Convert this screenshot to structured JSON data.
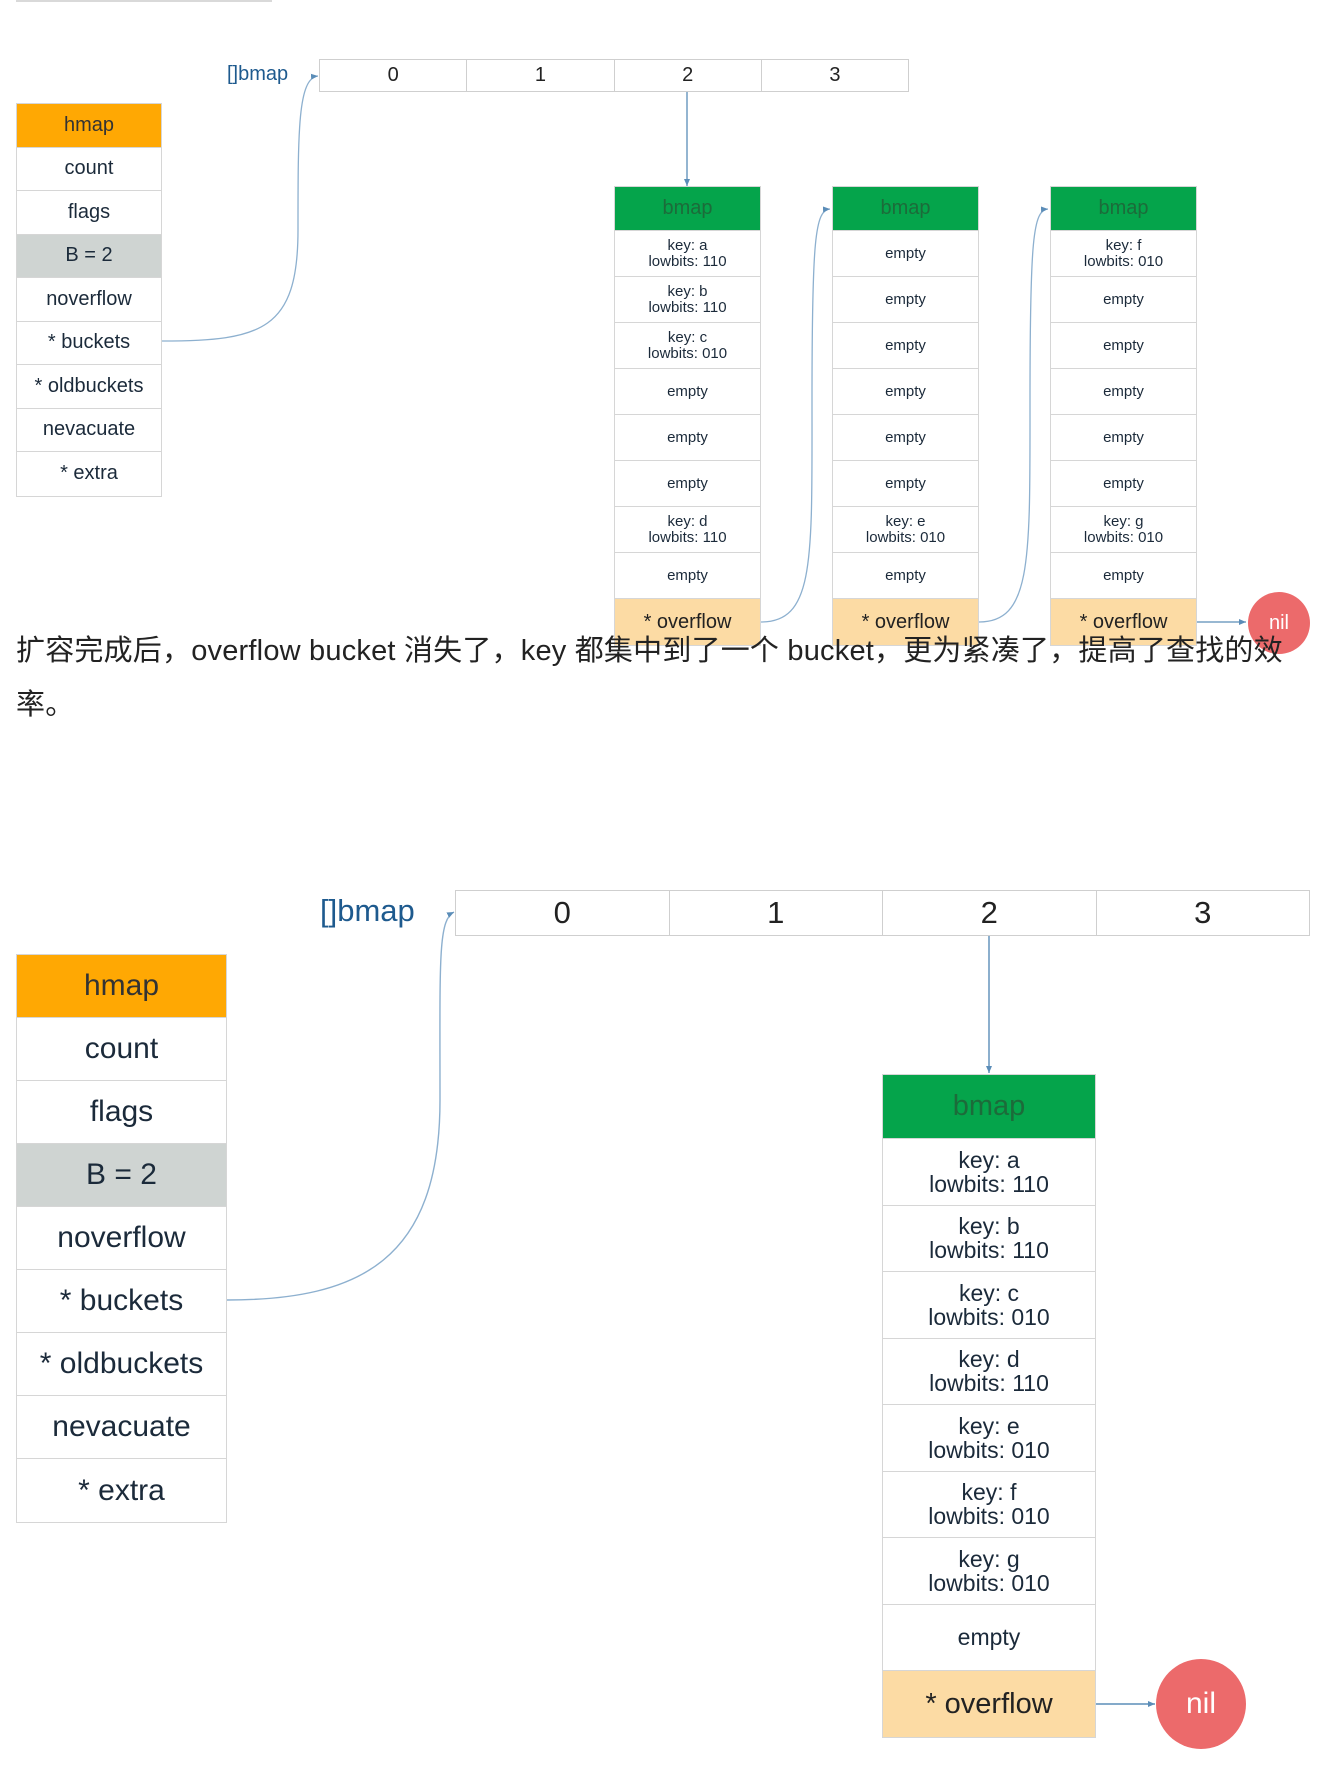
{
  "diagram1": {
    "array_label": "[]bmap",
    "array_indices": [
      "0",
      "1",
      "2",
      "3"
    ],
    "hmap_fields": [
      "hmap",
      "count",
      "flags",
      "B = 2",
      "noverflow",
      "* buckets",
      "* oldbuckets",
      "nevacuate",
      "* extra"
    ],
    "buckets": [
      {
        "header": "bmap",
        "cells": [
          [
            "key: a",
            "lowbits: 110"
          ],
          [
            "key: b",
            "lowbits: 110"
          ],
          [
            "key: c",
            "lowbits: 010"
          ],
          [
            "empty"
          ],
          [
            "empty"
          ],
          [
            "empty"
          ],
          [
            "key: d",
            "lowbits: 110"
          ],
          [
            "empty"
          ]
        ],
        "overflow": "* overflow"
      },
      {
        "header": "bmap",
        "cells": [
          [
            "empty"
          ],
          [
            "empty"
          ],
          [
            "empty"
          ],
          [
            "empty"
          ],
          [
            "empty"
          ],
          [
            "empty"
          ],
          [
            "key: e",
            "lowbits: 010"
          ],
          [
            "empty"
          ]
        ],
        "overflow": "* overflow"
      },
      {
        "header": "bmap",
        "cells": [
          [
            "key: f",
            "lowbits: 010"
          ],
          [
            "empty"
          ],
          [
            "empty"
          ],
          [
            "empty"
          ],
          [
            "empty"
          ],
          [
            "empty"
          ],
          [
            "key: g",
            "lowbits: 010"
          ],
          [
            "empty"
          ]
        ],
        "overflow": "* overflow"
      }
    ],
    "nil_label": "nil"
  },
  "paragraph": {
    "text": "扩容完成后，overflow bucket 消失了，key 都集中到了一个 bucket，更为紧凑了，提高了查找的效率。"
  },
  "diagram2": {
    "array_label": "[]bmap",
    "array_indices": [
      "0",
      "1",
      "2",
      "3"
    ],
    "hmap_fields": [
      "hmap",
      "count",
      "flags",
      "B = 2",
      "noverflow",
      "* buckets",
      "* oldbuckets",
      "nevacuate",
      "* extra"
    ],
    "bucket": {
      "header": "bmap",
      "cells": [
        [
          "key: a",
          "lowbits: 110"
        ],
        [
          "key: b",
          "lowbits: 110"
        ],
        [
          "key: c",
          "lowbits: 010"
        ],
        [
          "key: d",
          "lowbits: 110"
        ],
        [
          "key: e",
          "lowbits: 010"
        ],
        [
          "key: f",
          "lowbits: 010"
        ],
        [
          "key: g",
          "lowbits: 010"
        ],
        [
          "empty"
        ]
      ],
      "overflow": "* overflow"
    },
    "nil_label": "nil"
  },
  "colors": {
    "hmap_header": "#ffa803",
    "b_field": "#cfd4d2",
    "bmap_header": "#05a44b",
    "overflow_cell": "#fcdba4",
    "nil": "#ec6a6b",
    "connector": "#5b8db8",
    "array_label": "#1e5a8e"
  }
}
